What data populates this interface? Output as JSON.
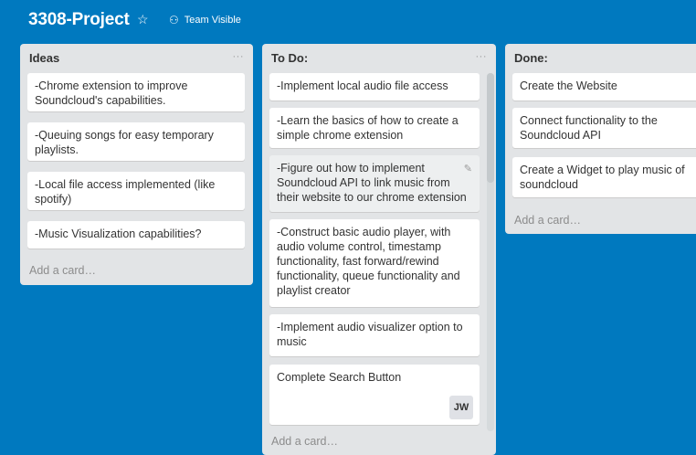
{
  "header": {
    "board_title": "3308-Project",
    "star_icon": "star-icon",
    "team_label": "Team Visible",
    "team_icon": "team-icon"
  },
  "lists": [
    {
      "title": "Ideas",
      "cards": [
        "-Chrome extension to improve Soundcloud's capabilities.",
        "-Queuing songs for easy temporary playlists.",
        "-Local file access implemented (like spotify)",
        "-Music Visualization capabilities?"
      ],
      "add_card": "Add a card…"
    },
    {
      "title": "To Do:",
      "cards": [
        "-Implement local audio file access",
        "-Learn the basics of how to create a simple chrome extension",
        "-Figure out how to implement Soundcloud API to link music from their website to our chrome extension",
        "-Construct basic audio player, with audio volume control, timestamp functionality, fast forward/rewind functionality, queue functionality and playlist creator",
        "-Implement audio visualizer option to music",
        "Complete Search Button"
      ],
      "avatar_initials": "JW",
      "add_card": "Add a card…"
    },
    {
      "title": "Done:",
      "cards": [
        "Create the Website",
        "Connect functionality to the Soundcloud API",
        "Create a Widget to play music of soundcloud"
      ],
      "add_card": "Add a card…"
    }
  ],
  "colors": {
    "board_background": "#0079bf",
    "list_background": "#e2e4e6",
    "card_background": "#ffffff"
  }
}
